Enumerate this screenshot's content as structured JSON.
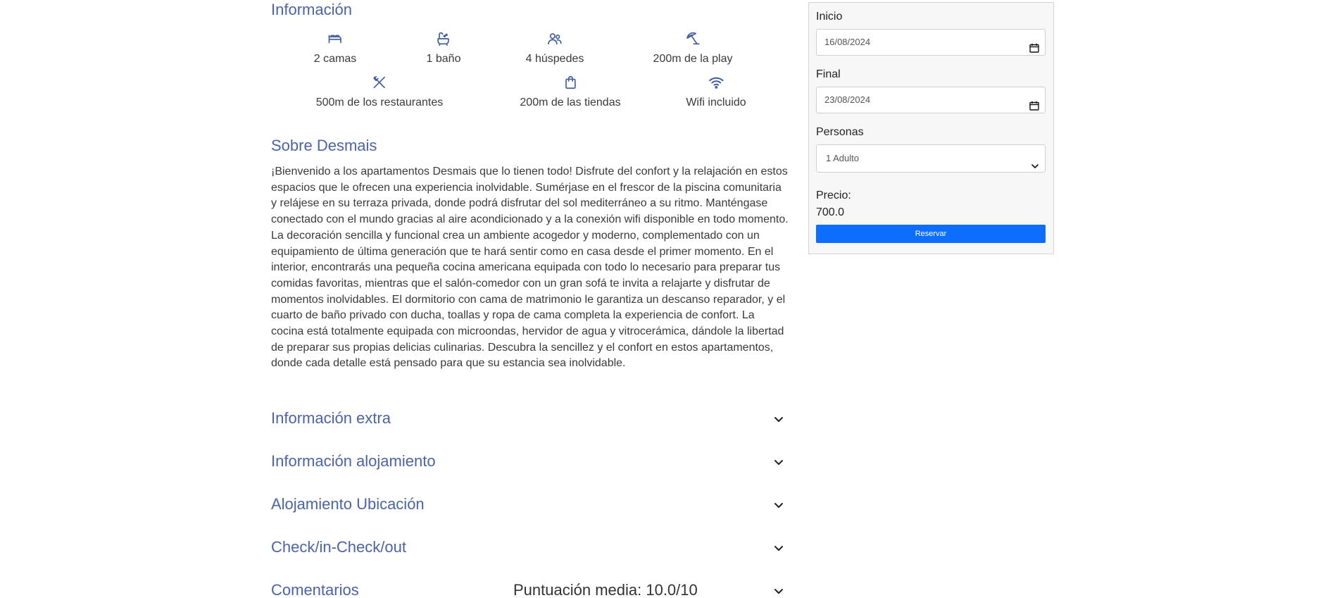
{
  "info": {
    "title": "Información",
    "amenities_row1": [
      {
        "icon": "bed-icon",
        "label": "2 camas"
      },
      {
        "icon": "bathtub-icon",
        "label": "1 baño"
      },
      {
        "icon": "guests-icon",
        "label": "4 húspedes"
      },
      {
        "icon": "beach-umbrella-icon",
        "label": "200m de la play"
      }
    ],
    "amenities_row2": [
      {
        "icon": "restaurant-icon",
        "label": "500m de los restaurantes"
      },
      {
        "icon": "shopping-bag-icon",
        "label": "200m de las tiendas"
      },
      {
        "icon": "wifi-icon",
        "label": "Wifi incluido"
      }
    ]
  },
  "about": {
    "title": "Sobre Desmais",
    "text": "¡Bienvenido a los apartamentos Desmais que lo tienen todo! Disfrute del confort y la relajación en estos espacios que le ofrecen una experiencia inolvidable. Sumérjase en el frescor de la piscina comunitaria y relájese en su terraza privada, donde podrá disfrutar del sol mediterráneo a su ritmo. Manténgase conectado con el mundo gracias al aire acondicionado y a la conexión wifi disponible en todo momento. La decoración sencilla y funcional crea un ambiente acogedor y moderno, complementado con un equipamiento de última generación que te hará sentir como en casa desde el primer momento. En el interior, encontrarás una pequeña cocina americana equipada con todo lo necesario para preparar tus comidas favoritas, mientras que el salón-comedor con un gran sofá te invita a relajarte y disfrutar de momentos inolvidables. El dormitorio con cama de matrimonio le garantiza un descanso reparador, y el cuarto de baño privado con ducha, toallas y ropa de cama completa la experiencia de confort. La cocina está totalmente equipada con microondas, hervidor de agua y vitrocerámica, dándole la libertad de preparar sus propias delicias culinarias. Descubra la sencillez y el confort en estos apartamentos, donde cada detalle está pensado para que su estancia sea inolvidable."
  },
  "accordion": [
    {
      "label": "Información extra"
    },
    {
      "label": "Información alojamiento"
    },
    {
      "label": "Alojamiento Ubicación"
    },
    {
      "label": "Check/in-Check/out"
    },
    {
      "label": "Comentarios",
      "extra": "Puntuación media: 10.0/10"
    }
  ],
  "booking": {
    "start_label": "Inicio",
    "start_value": "16/08/2024",
    "end_label": "Final",
    "end_value": "23/08/2024",
    "persons_label": "Personas",
    "persons_value": "1 Adulto",
    "price_label": "Precio:",
    "price_value": "700.0",
    "reserve_label": "Reservar"
  },
  "colors": {
    "heading": "#4a64a6",
    "button": "#0d6efd"
  }
}
